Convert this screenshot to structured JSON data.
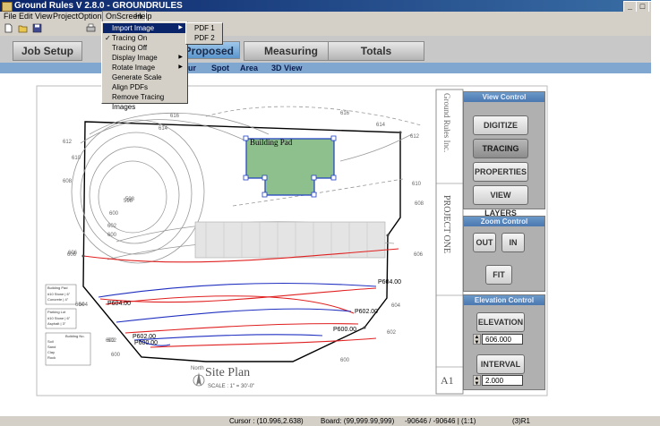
{
  "window": {
    "title": "Ground Rules V 2.8.0 - GROUNDRULES"
  },
  "window_controls": {
    "minimize": "_",
    "maximize": "□",
    "close": "×"
  },
  "menubar": [
    "File",
    "Edit",
    "View",
    "Project",
    "Options",
    "OnScreen",
    "Help"
  ],
  "onscreen_menu": {
    "items": [
      {
        "label": "Import Image",
        "submenu": true
      },
      {
        "label": "Tracing On",
        "checked": true
      },
      {
        "label": "Tracing Off"
      },
      {
        "label": "Display Image",
        "submenu": true
      },
      {
        "label": "Rotate Image",
        "submenu": true
      },
      {
        "label": "Generate Scale"
      },
      {
        "label": "Align PDFs"
      },
      {
        "label": "Remove Tracing Images"
      }
    ]
  },
  "import_submenu": [
    "PDF 1",
    "PDF 2"
  ],
  "tabs": [
    "Job Setup",
    "Proposed",
    "Measuring",
    "Totals"
  ],
  "subtabs": [
    "Contour",
    "Spot",
    "Area",
    "3D View"
  ],
  "view_control": {
    "header": "View Control",
    "buttons": [
      "DIGITIZE",
      "TRACING",
      "PROPERTIES",
      "VIEW LAYERS"
    ],
    "selected": "TRACING"
  },
  "zoom_control": {
    "header": "Zoom Control",
    "buttons": [
      "OUT",
      "IN",
      "FIT"
    ]
  },
  "elevation_control": {
    "header": "Elevation Control",
    "elevation_button": "ELEVATION",
    "elevation_value": "606.000",
    "interval_button": "INTERVAL",
    "interval_value": "2.000"
  },
  "drawing": {
    "building_pad_label": "Building Pad",
    "contour_labels": [
      "P604.00",
      "P604.00",
      "P602.00",
      "P600.00",
      "P602.00",
      "P600.00"
    ],
    "elevation_marks": [
      "616",
      "614",
      "612",
      "610",
      "608",
      "606",
      "604",
      "602",
      "600",
      "598",
      "616",
      "614",
      "612",
      "610",
      "608",
      "606",
      "604",
      "602",
      "600",
      "606",
      "604",
      "602",
      "600",
      "602",
      "600",
      "598"
    ],
    "title": "Site Plan",
    "scale": "SCALE : 1\" = 30'-0\"",
    "north": "North",
    "company": "Ground Rules Inc.",
    "project": "PROJECT ONE",
    "sheet": "A1",
    "table1_title": "Building Pad",
    "table1_rows": [
      "#10 Stone | 6\"",
      "Concrete | 4\""
    ],
    "table2_title": "Parking Lot",
    "table2_rows": [
      "#10 Stone | 6\"",
      "Asphalt | 3\""
    ],
    "table3_title": "Building No.",
    "table3_rows": [
      "Soil",
      "Sand",
      "Clay",
      "Rock"
    ]
  },
  "status": {
    "cursor": "Cursor : (10.996,2.638)",
    "board": "Board: (99,999.99,999)",
    "extra": "-90646 / -90646 | (1:1)",
    "page": "(3)R1"
  },
  "colors": {
    "title_start": "#0a246a",
    "tab_selected": "#5a95cc",
    "building_fill": "#8dc08c",
    "red_contour": "#e02020",
    "blue_contour": "#2030c0"
  }
}
